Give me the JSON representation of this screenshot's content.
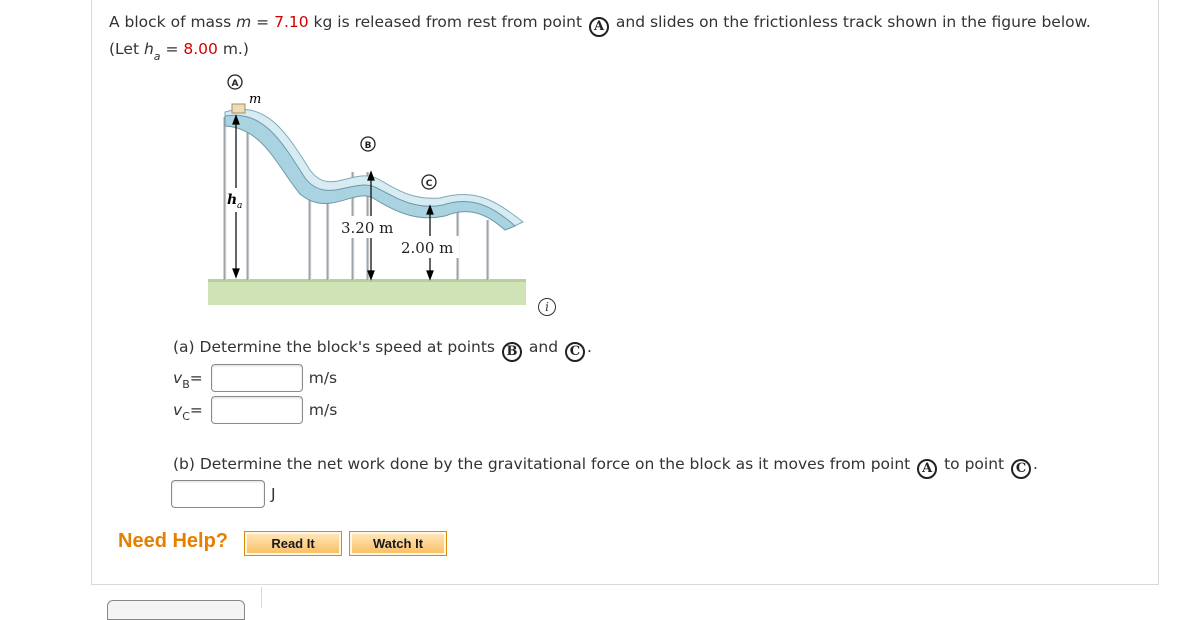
{
  "problem": {
    "intro_1": "A block of mass ",
    "mass_var": "m",
    "eq": " = ",
    "mass_value": "7.10",
    "intro_2": " kg is released from rest from point ",
    "point_a": "A",
    "intro_3": " and slides on the frictionless track shown in the figure below.",
    "let_open": "(Let ",
    "h_var": "h",
    "h_sub": "a",
    "h_value": "8.00",
    "let_close": " m.)"
  },
  "figure": {
    "label_a": "A",
    "label_m": "m",
    "label_b": "B",
    "label_c": "C",
    "label_ha": "h",
    "label_ha_sub": "a",
    "height_b": "3.20 m",
    "height_c": "2.00 m"
  },
  "info_icon_glyph": "i",
  "part_a": {
    "question": "(a) Determine the block's speed at points ",
    "point_b": "B",
    "and": " and ",
    "point_c": "C",
    "end": ".",
    "vb_var": "v",
    "vb_sub": "B",
    "vc_var": "v",
    "vc_sub": "C",
    "equals": " =",
    "vb_value": "",
    "vc_value": "",
    "unit": "m/s"
  },
  "part_b": {
    "question": "(b) Determine the net work done by the gravitational force on the block as it moves from point ",
    "point_a": "A",
    "to_point": " to point ",
    "point_c": "C",
    "end": ".",
    "value": "",
    "unit": "J"
  },
  "help": {
    "label": "Need Help?",
    "read_it": "Read It",
    "watch_it": "Watch It"
  },
  "colors": {
    "given_value": "#d10000",
    "need_help": "#e67e00",
    "track": "#bfe0ea",
    "ground": "#cfe3b6"
  }
}
